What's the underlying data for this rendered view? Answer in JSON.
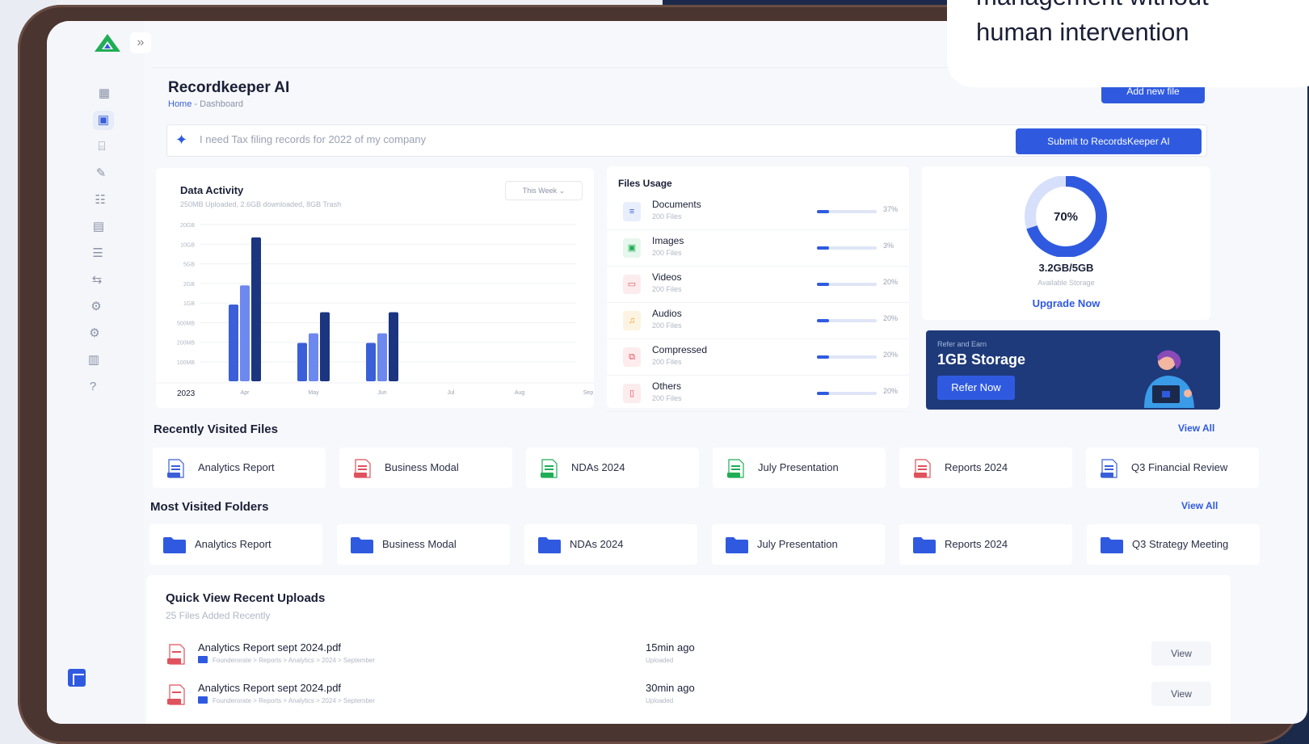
{
  "app": {
    "title": "Recordkeeper AI",
    "breadcrumb_home": "Home",
    "breadcrumb_sep": " - ",
    "breadcrumb_current": "Dashboard"
  },
  "header": {
    "add_new_file": "Add new file"
  },
  "search": {
    "placeholder": "I need Tax filing records for 2022 of my company",
    "submit_label": "Submit to RecordsKeeper AI"
  },
  "sidebar": {
    "expand_icon": "double-chevron-right-icon",
    "items": [
      {
        "icon": "dashboard-icon",
        "active": false
      },
      {
        "icon": "records-icon",
        "active": true
      },
      {
        "icon": "data-folder-icon",
        "active": false
      },
      {
        "icon": "document-edit-icon",
        "active": false
      },
      {
        "icon": "users-group-icon",
        "active": false
      },
      {
        "icon": "calendar-search-icon",
        "active": false
      },
      {
        "icon": "user-list-icon",
        "active": false
      },
      {
        "icon": "transfer-icon",
        "active": false
      },
      {
        "icon": "chip-icon",
        "active": false
      },
      {
        "icon": "settings-icon",
        "active": false
      },
      {
        "icon": "briefcase-icon",
        "active": false
      },
      {
        "icon": "help-icon",
        "active": false
      }
    ]
  },
  "data_activity": {
    "title": "Data Activity",
    "subtitle": "250MB Uploaded, 2.6GB downloaded, 8GB Trash",
    "period": "This Week",
    "year_label": "2023"
  },
  "chart_data": {
    "type": "bar",
    "title": "Data Activity",
    "categories": [
      "Apr",
      "May",
      "Jun",
      "Jul",
      "Aug",
      "Sep"
    ],
    "y_ticks": [
      "20GB",
      "10GB",
      "5GB",
      "2GB",
      "1GB",
      "500MB",
      "200MB",
      "100MB"
    ],
    "series": [
      {
        "values": [
          4,
          2,
          2,
          0,
          0,
          0
        ],
        "color": "#3a5fd8"
      },
      {
        "values": [
          5,
          2.5,
          2.5,
          0,
          0,
          0
        ],
        "color": "#6d88ee"
      },
      {
        "values": [
          7.5,
          3.6,
          3.6,
          0,
          0,
          0
        ],
        "color": "#1b3580"
      }
    ],
    "ylim": [
      0,
      8
    ],
    "grid": true
  },
  "files_usage": {
    "title": "Files Usage",
    "items": [
      {
        "name": "Documents",
        "count": "200 Files",
        "percent": "37%",
        "fill": 0.2,
        "icon": "document-icon",
        "color": "#3a5fd8",
        "bg": "#e8eefc"
      },
      {
        "name": "Images",
        "count": "200 Files",
        "percent": "3%",
        "fill": 0.2,
        "icon": "image-icon",
        "color": "#1fae55",
        "bg": "#e6f7ed"
      },
      {
        "name": "Videos",
        "count": "200 Files",
        "percent": "20%",
        "fill": 0.2,
        "icon": "video-icon",
        "color": "#e0525c",
        "bg": "#fdeced"
      },
      {
        "name": "Audios",
        "count": "200 Files",
        "percent": "20%",
        "fill": 0.2,
        "icon": "audio-icon",
        "color": "#f0a020",
        "bg": "#fdf3e2"
      },
      {
        "name": "Compressed",
        "count": "200 Files",
        "percent": "20%",
        "fill": 0.2,
        "icon": "zip-icon",
        "color": "#e0525c",
        "bg": "#fdeced"
      },
      {
        "name": "Others",
        "count": "200 Files",
        "percent": "20%",
        "fill": 0.2,
        "icon": "file-icon",
        "color": "#e0525c",
        "bg": "#fdeced"
      }
    ]
  },
  "storage": {
    "percent_label": "70%",
    "percent": 70,
    "amount": "3.2GB/5GB",
    "label": "Available Storage",
    "upgrade": "Upgrade Now"
  },
  "refer": {
    "small": "Refer and Earn",
    "title": "1GB Storage",
    "button": "Refer Now"
  },
  "recent_files": {
    "title": "Recently Visited Files",
    "view_all": "View All",
    "items": [
      {
        "label": "Analytics Report",
        "icon": "docx-file-icon",
        "color": "#3a5fd8"
      },
      {
        "label": "Business Modal",
        "icon": "pdf-file-icon",
        "color": "#e0525c"
      },
      {
        "label": "NDAs 2024",
        "icon": "csv-file-icon",
        "color": "#1fae55"
      },
      {
        "label": "July Presentation",
        "icon": "csv-file-icon",
        "color": "#1fae55"
      },
      {
        "label": "Reports 2024",
        "icon": "mp3-file-icon",
        "color": "#e0525c"
      },
      {
        "label": "Q3 Financial Review",
        "icon": "docx-file-icon",
        "color": "#3a5fd8"
      }
    ]
  },
  "folders": {
    "title": "Most Visited Folders",
    "view_all": "View All",
    "items": [
      {
        "label": "Analytics Report"
      },
      {
        "label": "Business Modal"
      },
      {
        "label": "NDAs 2024"
      },
      {
        "label": "July Presentation"
      },
      {
        "label": "Reports 2024"
      },
      {
        "label": "Q3 Strategy Meeting"
      }
    ]
  },
  "uploads": {
    "title": "Quick View Recent Uploads",
    "subtitle": "25 Files Added Recently",
    "rows": [
      {
        "name": "Analytics Report sept 2024.pdf",
        "path": "Founderorate > Reports > Analytics > 2024 > September",
        "time": "15min ago",
        "status": "Uploaded",
        "action": "View"
      },
      {
        "name": "Analytics Report sept 2024.pdf",
        "path": "Founderorate > Reports > Analytics > 2024 > September",
        "time": "30min ago",
        "status": "Uploaded",
        "action": "View"
      }
    ]
  },
  "overlay": {
    "line1": "management without",
    "line2": "human intervention"
  }
}
